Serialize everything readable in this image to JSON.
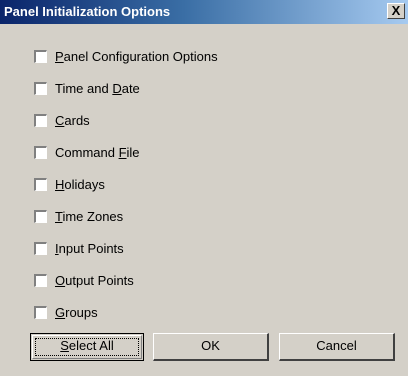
{
  "window": {
    "title": "Panel Initialization Options",
    "close_glyph": "X"
  },
  "options": [
    {
      "pre": "",
      "key": "P",
      "post": "anel Configuration Options",
      "checked": false
    },
    {
      "pre": "Time and ",
      "key": "D",
      "post": "ate",
      "checked": false
    },
    {
      "pre": "",
      "key": "C",
      "post": "ards",
      "checked": false
    },
    {
      "pre": "Command ",
      "key": "F",
      "post": "ile",
      "checked": false
    },
    {
      "pre": "",
      "key": "H",
      "post": "olidays",
      "checked": false
    },
    {
      "pre": "",
      "key": "T",
      "post": "ime Zones",
      "checked": false
    },
    {
      "pre": "",
      "key": "I",
      "post": "nput Points",
      "checked": false
    },
    {
      "pre": "",
      "key": "O",
      "post": "utput Points",
      "checked": false
    },
    {
      "pre": "",
      "key": "G",
      "post": "roups",
      "checked": false
    }
  ],
  "buttons": {
    "select_all": {
      "key": "S",
      "post": "elect All"
    },
    "ok": "OK",
    "cancel": "Cancel"
  },
  "colors": {
    "title_gradient_start": "#0a246a",
    "title_gradient_end": "#a6caf0",
    "face": "#d4d0c8"
  }
}
